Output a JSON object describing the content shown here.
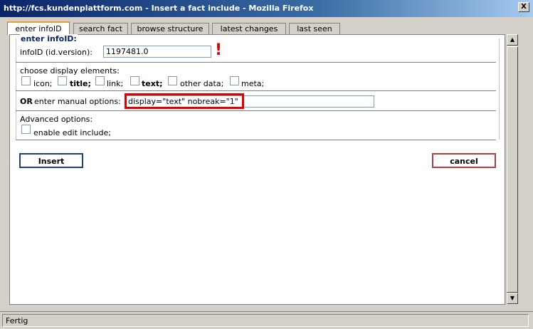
{
  "window": {
    "title": "http://fcs.kundenplattform.com - Insert a fact include - Mozilla Firefox",
    "close_label": "X"
  },
  "tabs": [
    {
      "label": "enter infoID"
    },
    {
      "label": "search fact"
    },
    {
      "label": "browse structure"
    },
    {
      "label": "latest changes"
    },
    {
      "label": "last seen"
    }
  ],
  "form": {
    "legend": "enter infoID:",
    "infoid_label": "infoID (id.version):",
    "infoid_value": "1197481.0",
    "warning_mark": "!",
    "display_label": "choose display elements:",
    "elements": [
      {
        "label": "icon;",
        "bold": false
      },
      {
        "label": "title;",
        "bold": true
      },
      {
        "label": "link;",
        "bold": false
      },
      {
        "label": "text;",
        "bold": true
      },
      {
        "label": "other data;",
        "bold": false
      },
      {
        "label": "meta;",
        "bold": false
      }
    ],
    "manual_or": "OR",
    "manual_label": "enter manual options:",
    "manual_value": "display=\"text\" nobreak=\"1\"",
    "advanced_label": "Advanced options:",
    "edit_include_label": "enable edit include;",
    "insert_button": "Insert",
    "cancel_button": "cancel"
  },
  "status": {
    "text": "Fertig"
  },
  "colors": {
    "title_bar": "#0a246a",
    "highlight": "#e00000",
    "legend": "#0a246a"
  },
  "icons": {
    "scroll_up": "scroll-up-icon",
    "scroll_down": "scroll-down-icon"
  }
}
